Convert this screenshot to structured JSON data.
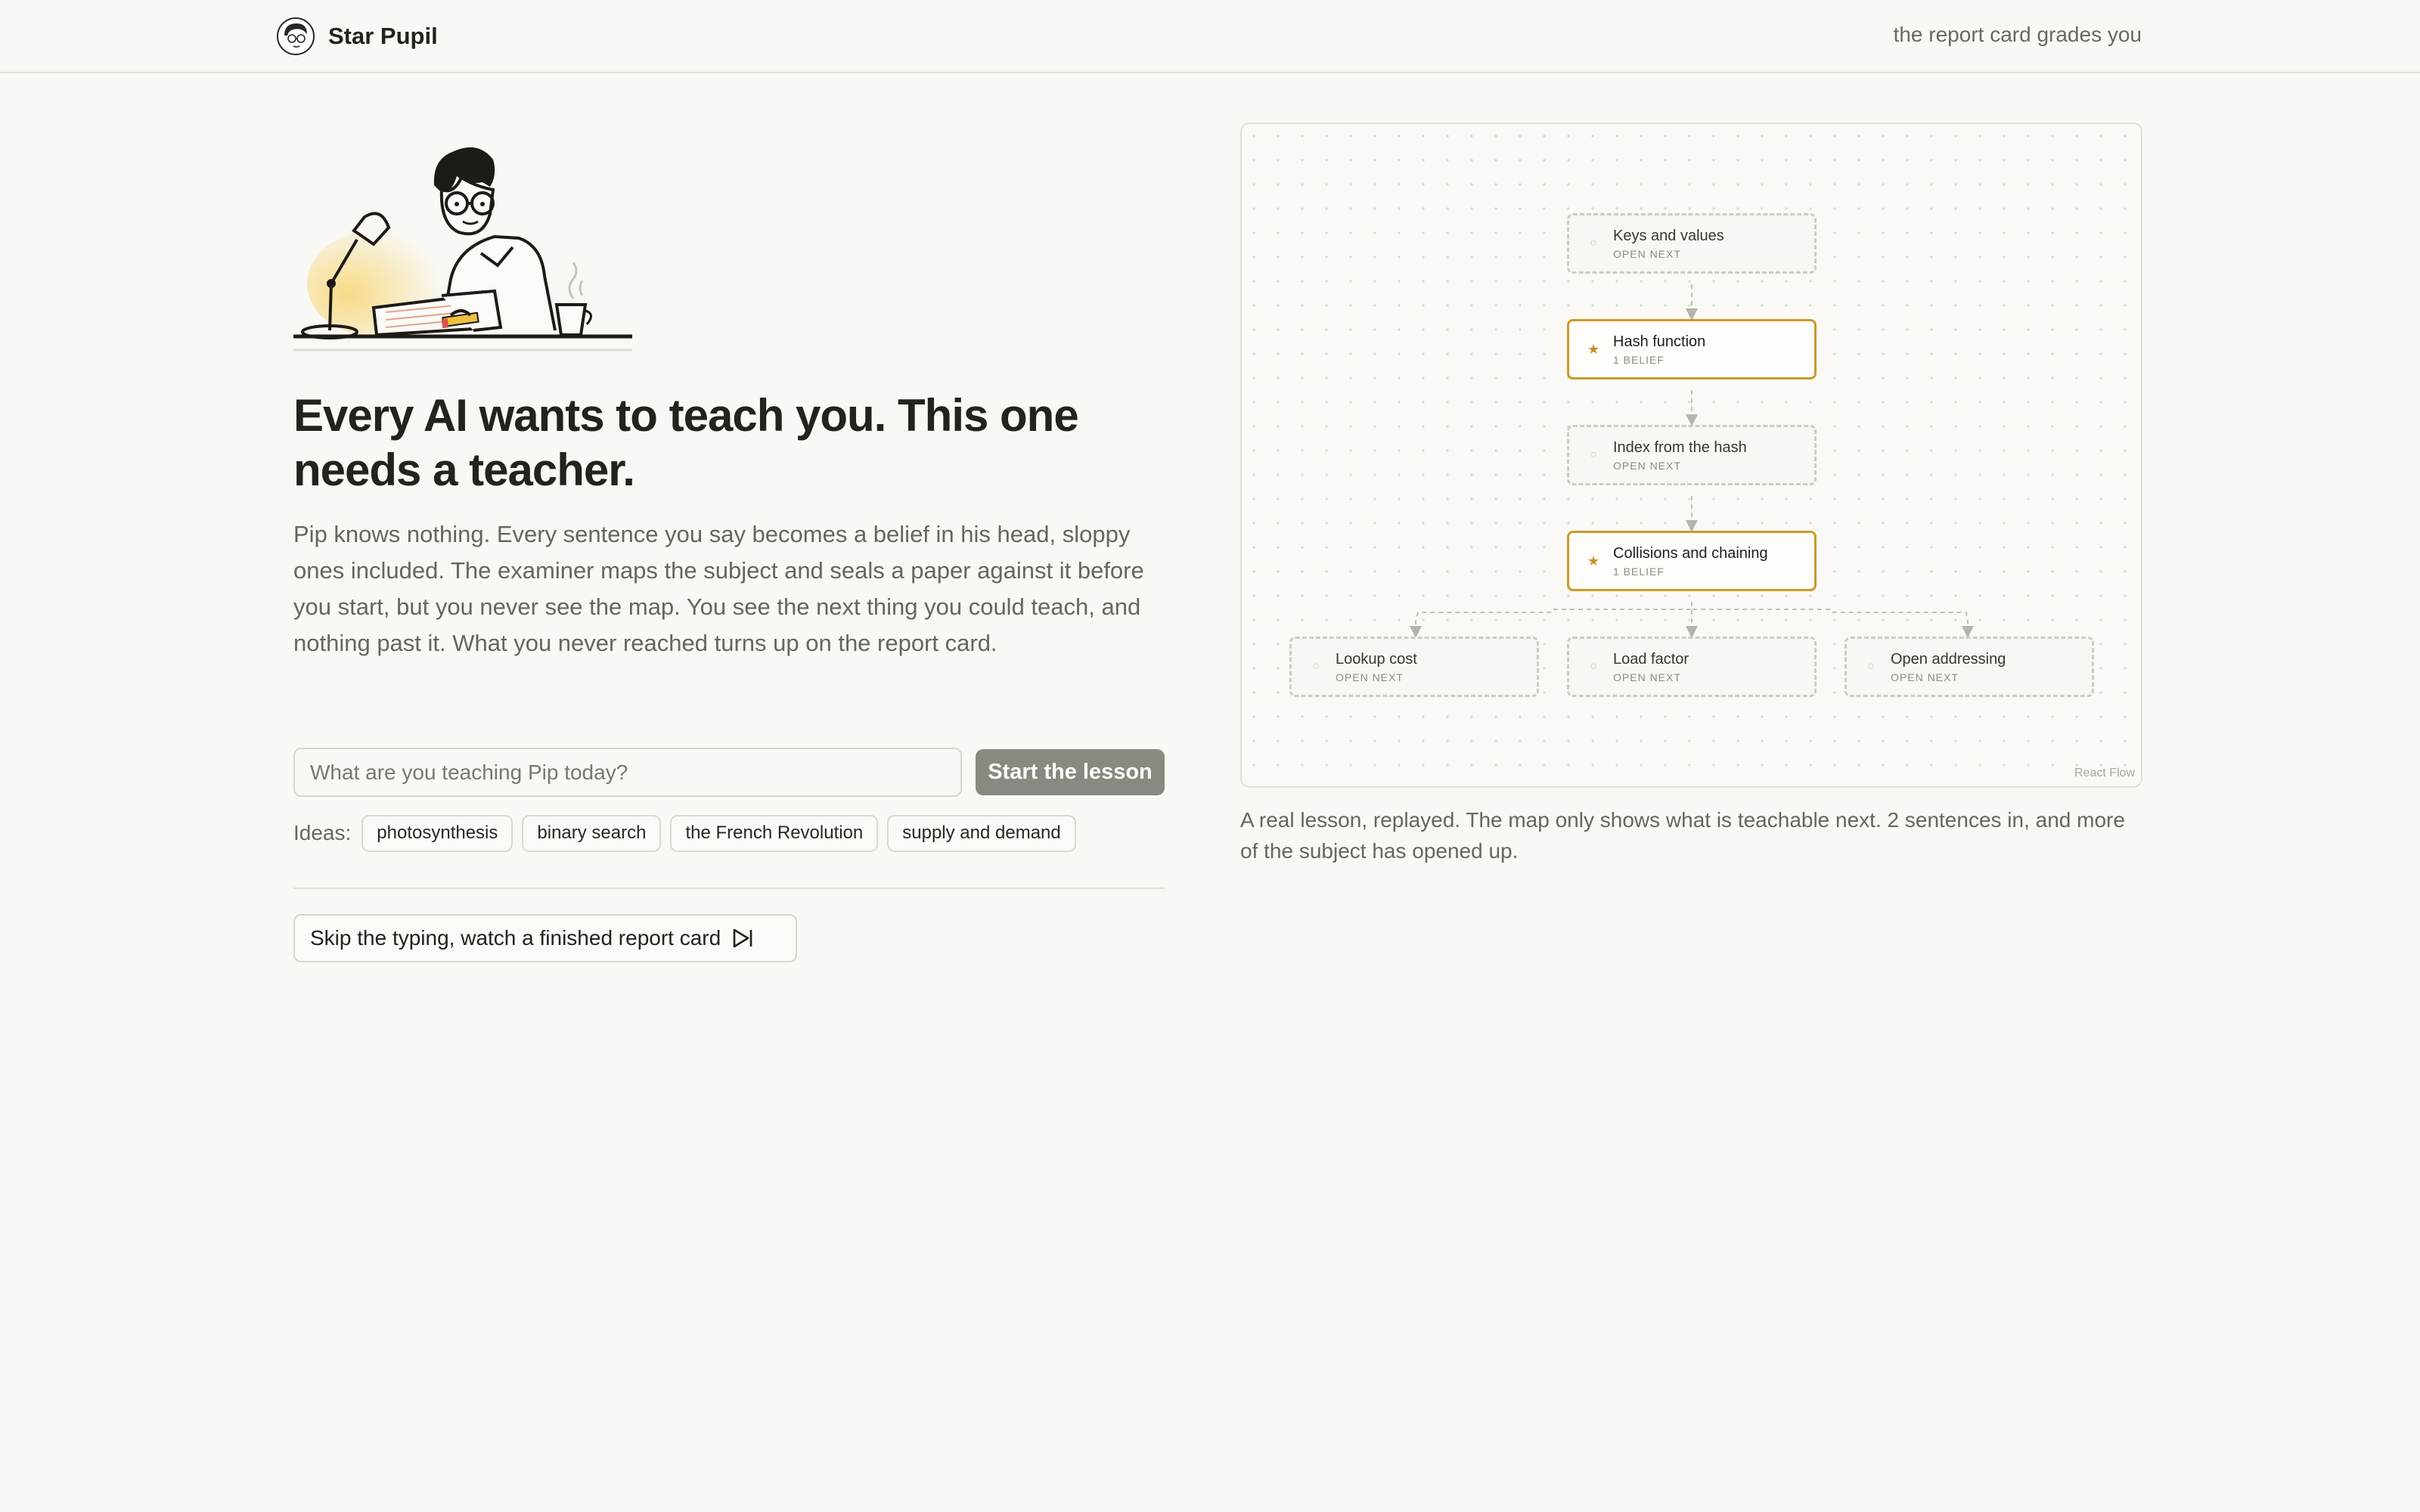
{
  "header": {
    "brand_name": "Star Pupil",
    "tagline": "the report card grades you"
  },
  "hero": {
    "headline": "Every AI wants to teach you. This one needs a teacher.",
    "lede": "Pip knows nothing. Every sentence you say becomes a belief in his head, sloppy ones included. The examiner maps the subject and seals a paper against it before you start, but you never see the map. You see the next thing you could teach, and nothing past it. What you never reached turns up on the report card."
  },
  "composer": {
    "placeholder": "What are you teaching Pip today?",
    "value": "",
    "start_label": "Start the lesson"
  },
  "ideas": {
    "label": "Ideas:",
    "chips": [
      "photosynthesis",
      "binary search",
      "the French Revolution",
      "supply and demand"
    ]
  },
  "skip": {
    "label": "Skip the typing, watch a finished report card",
    "icon": "skip-to-end-icon"
  },
  "flow": {
    "nodes": [
      {
        "title": "Keys and values",
        "status": "OPEN NEXT",
        "state": "open"
      },
      {
        "title": "Hash function",
        "status": "1 BELIEF",
        "state": "active"
      },
      {
        "title": "Index from the hash",
        "status": "OPEN NEXT",
        "state": "open"
      },
      {
        "title": "Collisions and chaining",
        "status": "1 BELIEF",
        "state": "active"
      },
      {
        "title": "Lookup cost",
        "status": "OPEN NEXT",
        "state": "open"
      },
      {
        "title": "Load factor",
        "status": "OPEN NEXT",
        "state": "open"
      },
      {
        "title": "Open addressing",
        "status": "OPEN NEXT",
        "state": "open"
      }
    ],
    "attribution": "React Flow",
    "colors": {
      "active_border": "#cb9a2b",
      "open_border": "#cfcbc3"
    }
  },
  "caption": "A real lesson, replayed. The map only shows what is teachable next. 2 sentences in, and more of the subject has opened up."
}
